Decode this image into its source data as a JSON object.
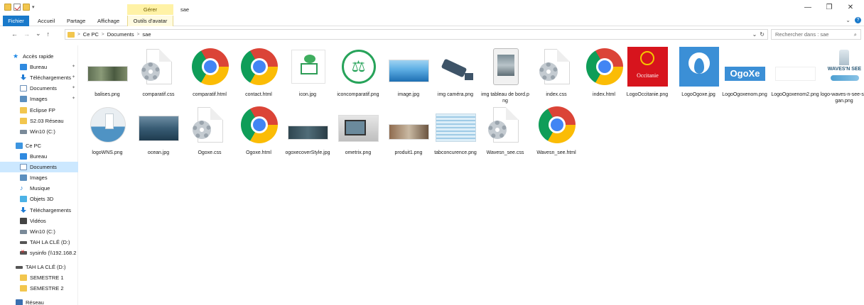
{
  "window": {
    "title": "sae",
    "contextual_group": "Gérer",
    "controls": {
      "minimize": "—",
      "maximize": "❐",
      "close": "✕"
    }
  },
  "ribbon": {
    "tabs": [
      {
        "label": "Fichier"
      },
      {
        "label": "Accueil"
      },
      {
        "label": "Partage"
      },
      {
        "label": "Affichage"
      },
      {
        "label": "Outils d'avatar"
      }
    ],
    "expand": "⌄",
    "help": "?"
  },
  "nav": {
    "back": "←",
    "forward": "→",
    "recent": "⌄",
    "up": "↑"
  },
  "address": {
    "path": [
      {
        "label": "Ce PC"
      },
      {
        "label": "Documents"
      },
      {
        "label": "sae"
      }
    ],
    "separator": ">",
    "dropdown": "⌄",
    "refresh": "↻"
  },
  "search": {
    "placeholder": "Rechercher dans : sae",
    "icon": "⌕"
  },
  "sidebar": {
    "items": [
      {
        "label": "Accès rapide",
        "icon": "star-icon",
        "pinned": false
      },
      {
        "label": "Bureau",
        "icon": "desktop-icon",
        "pinned": true
      },
      {
        "label": "Téléchargements",
        "icon": "download-icon",
        "pinned": true
      },
      {
        "label": "Documents",
        "icon": "documents-icon",
        "pinned": true
      },
      {
        "label": "Images",
        "icon": "images-icon",
        "pinned": true
      },
      {
        "label": "Eclipse FP",
        "icon": "folder-icon",
        "pinned": false
      },
      {
        "label": "S2.03 Réseau",
        "icon": "folder-icon",
        "pinned": false
      },
      {
        "label": "Win10 (C:)",
        "icon": "drive-icon",
        "pinned": false
      },
      {
        "label": "Ce PC",
        "icon": "pc-icon",
        "pinned": false
      },
      {
        "label": "Bureau",
        "icon": "desktop-icon",
        "pinned": false
      },
      {
        "label": "Documents",
        "icon": "documents-icon",
        "pinned": false
      },
      {
        "label": "Images",
        "icon": "images-icon",
        "pinned": false
      },
      {
        "label": "Musique",
        "icon": "music-icon",
        "pinned": false
      },
      {
        "label": "Objets 3D",
        "icon": "objects3d-icon",
        "pinned": false
      },
      {
        "label": "Téléchargements",
        "icon": "download-icon",
        "pinned": false
      },
      {
        "label": "Vidéos",
        "icon": "videos-icon",
        "pinned": false
      },
      {
        "label": "Win10 (C:)",
        "icon": "drive-icon",
        "pinned": false
      },
      {
        "label": "TAH LA CLÉ (D:)",
        "icon": "usb-drive-icon",
        "pinned": false
      },
      {
        "label": "sysinfo (\\\\192.168.2",
        "icon": "network-drive-disconnected-icon",
        "pinned": false
      },
      {
        "label": "TAH LA CLÉ (D:)",
        "icon": "usb-drive-icon",
        "pinned": false
      },
      {
        "label": "SEMESTRE 1",
        "icon": "folder-icon",
        "pinned": false
      },
      {
        "label": "SEMESTRE 2",
        "icon": "folder-icon",
        "pinned": false
      },
      {
        "label": "Réseau",
        "icon": "network-icon",
        "pinned": false
      }
    ],
    "pin_glyph": "📌",
    "selected_index": 10
  },
  "files": [
    {
      "name": "balises.png",
      "thumb": "photo-strip"
    },
    {
      "name": "comparatif.css",
      "thumb": "css-file-icon"
    },
    {
      "name": "comparatif.html",
      "thumb": "chrome-icon"
    },
    {
      "name": "contact.html",
      "thumb": "chrome-icon"
    },
    {
      "name": "icon.jpg",
      "thumb": "tree-monitor-logo"
    },
    {
      "name": "iconcomparatif.png",
      "thumb": "scales-logo"
    },
    {
      "name": "image.jpg",
      "thumb": "sea-photo"
    },
    {
      "name": "img caméra.png",
      "thumb": "camera-icon"
    },
    {
      "name": "img tableau de bord.png",
      "thumb": "tablet-screenshot"
    },
    {
      "name": "index.css",
      "thumb": "css-file-icon"
    },
    {
      "name": "index.html",
      "thumb": "chrome-icon"
    },
    {
      "name": "LogoOccitanie.png",
      "thumb": "occitanie-logo",
      "text": "Occitanie"
    },
    {
      "name": "LogoOgoxe.jpg",
      "thumb": "water-drop-logo"
    },
    {
      "name": "LogoOgoxenom.png",
      "thumb": "ogoxe-wordmark",
      "text": "OgoXe"
    },
    {
      "name": "LogoOgoxenom2.png",
      "thumb": "blank-wordmark"
    },
    {
      "name": "logo-waves-n-see-slogan.png",
      "thumb": "waves-logo",
      "text": "WAVES'N SEE"
    },
    {
      "name": "logoWNS.png",
      "thumb": "lighthouse-logo"
    },
    {
      "name": "ocean.jpg",
      "thumb": "ocean-photo"
    },
    {
      "name": "Ogoxe.css",
      "thumb": "css-file-icon"
    },
    {
      "name": "Ogoxe.html",
      "thumb": "chrome-icon"
    },
    {
      "name": "ogoxecoverStyle.jpg",
      "thumb": "cover-photo"
    },
    {
      "name": "ometrix.png",
      "thumb": "device-photo"
    },
    {
      "name": "produit1.png",
      "thumb": "product-photo"
    },
    {
      "name": "tabconcurence.png",
      "thumb": "table-screenshot"
    },
    {
      "name": "Wavesn_see.css",
      "thumb": "css-file-icon"
    },
    {
      "name": "Wavesn_see.html",
      "thumb": "chrome-icon"
    }
  ]
}
